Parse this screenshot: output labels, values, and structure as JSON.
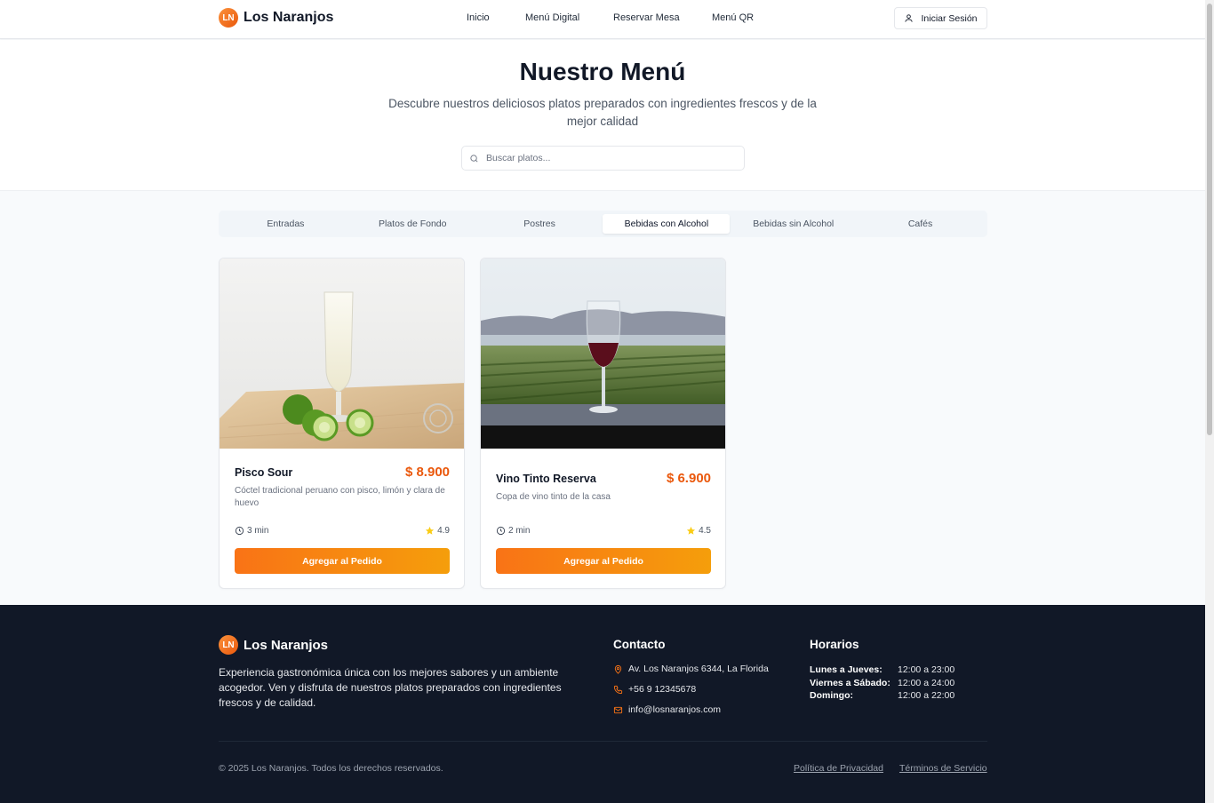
{
  "header": {
    "logo_initials": "LN",
    "brand": "Los Naranjos",
    "nav": [
      "Inicio",
      "Menú Digital",
      "Reservar Mesa",
      "Menú QR"
    ],
    "login_label": "Iniciar Sesión"
  },
  "hero": {
    "title": "Nuestro Menú",
    "subtitle": "Descubre nuestros deliciosos platos preparados con ingredientes frescos y de la mejor calidad",
    "search_placeholder": "Buscar platos..."
  },
  "tabs": {
    "items": [
      "Entradas",
      "Platos de Fondo",
      "Postres",
      "Bebidas con Alcohol",
      "Bebidas sin Alcohol",
      "Cafés"
    ],
    "active": "Bebidas con Alcohol"
  },
  "menu_items": [
    {
      "name": "Pisco Sour",
      "price": "$ 8.900",
      "description": "Cóctel tradicional peruano con pisco, limón y clara de huevo",
      "time": "3 min",
      "rating": "4.9",
      "button": "Agregar al Pedido",
      "image": "pisco-sour-photo"
    },
    {
      "name": "Vino Tinto Reserva",
      "price": "$ 6.900",
      "description": "Copa de vino tinto de la casa",
      "time": "2 min",
      "rating": "4.5",
      "button": "Agregar al Pedido",
      "image": "red-wine-vineyard-photo"
    }
  ],
  "footer": {
    "logo_initials": "LN",
    "brand": "Los Naranjos",
    "description": "Experiencia gastronómica única con los mejores sabores y un ambiente acogedor. Ven y disfruta de nuestros platos preparados con ingredientes frescos y de calidad.",
    "contact_title": "Contacto",
    "address": "Av. Los Naranjos 6344, La Florida",
    "phone": "+56 9 12345678",
    "email": "info@losnaranjos.com",
    "hours_title": "Horarios",
    "hours": [
      {
        "day": "Lunes a Jueves:",
        "time": "12:00 a 23:00"
      },
      {
        "day": "Viernes a Sábado:",
        "time": "12:00 a 24:00"
      },
      {
        "day": "Domingo:",
        "time": "12:00 a 22:00"
      }
    ],
    "copyright": "© 2025 Los Naranjos. Todos los derechos reservados.",
    "privacy": "Política de Privacidad",
    "terms": "Términos de Servicio"
  },
  "colors": {
    "accent": "#ea580c",
    "button_gradient_start": "#f97316",
    "button_gradient_end": "#f59e0b",
    "footer_bg": "#111827",
    "star": "#facc15"
  }
}
